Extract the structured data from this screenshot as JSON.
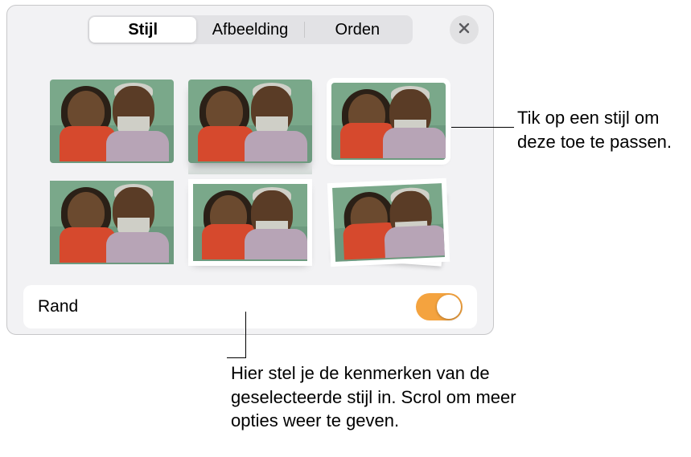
{
  "tabs": {
    "style": "Stijl",
    "image": "Afbeelding",
    "arrange": "Orden"
  },
  "border": {
    "label": "Rand",
    "enabled": true
  },
  "callouts": {
    "apply_style": "Tik op een stijl om deze toe te passen.",
    "set_attributes": "Hier stel je de kenmerken van de geselecteerde stijl in. Scrol om meer opties weer te geven."
  }
}
